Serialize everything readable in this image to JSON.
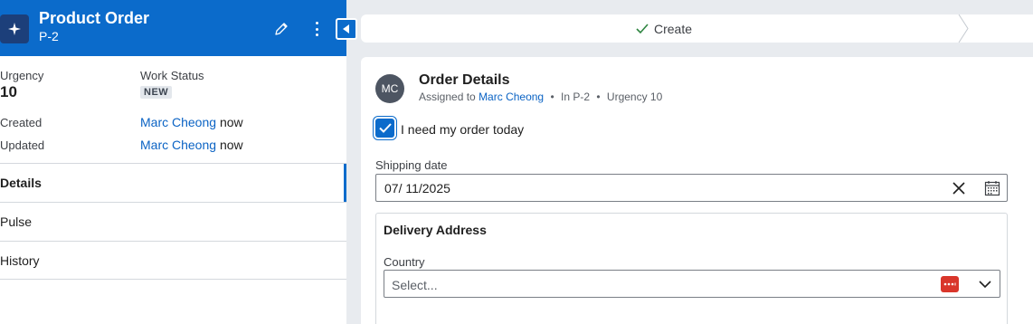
{
  "header": {
    "title": "Product Order",
    "subtitle": "P-2",
    "icon": "sparkle-icon",
    "color": "#0b6bcb"
  },
  "summary": {
    "urgency_label": "Urgency",
    "urgency_value": "10",
    "work_status_label": "Work Status",
    "work_status_value": "NEW",
    "created_label": "Created",
    "created_by": "Marc Cheong",
    "created_when": "now",
    "updated_label": "Updated",
    "updated_by": "Marc Cheong",
    "updated_when": "now"
  },
  "tabs": [
    {
      "label": "Details",
      "active": true
    },
    {
      "label": "Pulse",
      "active": false
    },
    {
      "label": "History",
      "active": false
    }
  ],
  "stages": {
    "current": "Create"
  },
  "card": {
    "avatar_initials": "MC",
    "title": "Order Details",
    "assigned_prefix": "Assigned to",
    "assignee": "Marc Cheong",
    "in_case": "In P-2",
    "urgency": "Urgency 10",
    "checkbox_label": "I need my order today",
    "checkbox_checked": true,
    "shipping_label": "Shipping date",
    "shipping_value": "07/ 11/2025",
    "address_title": "Delivery Address",
    "country_label": "Country",
    "country_placeholder": "Select..."
  }
}
